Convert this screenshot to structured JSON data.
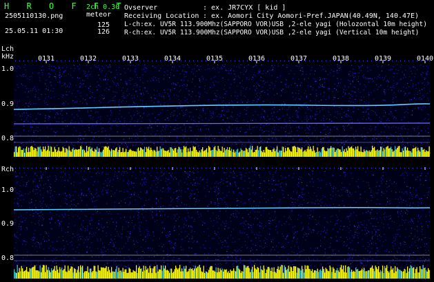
{
  "header": {
    "app_title": "H R O F F T",
    "version": "2ch 0.30",
    "filename": "2505110130.png",
    "mode": "meteor",
    "datetime": "25.05.11 01:30",
    "lch_count": "125",
    "rch_count": "126",
    "observer_label": "Ovserver",
    "observer_value": ": ex. JR7CYX [ kid ]",
    "location_label": "Receiving Location",
    "location_value": ": ex. Aomori City Aomori-Pref.JAPAN(40.49N, 140.47E)",
    "lch_info": "L-ch:ex. UV5R 113.900Mhz(SAPPORO VOR)USB ,2-ele yagi (Holozontal 10m height)",
    "rch_info": "R-ch:ex. UV5R 113.900Mhz(SAPPORO VOR)USB ,2-ele yagi (Vertical 10m height)"
  },
  "time_ticks": [
    "0131",
    "0132",
    "0133",
    "0134",
    "0135",
    "0136",
    "0137",
    "0138",
    "0139",
    "0140"
  ],
  "left_channel": {
    "label": "Lch",
    "unit": "kHz",
    "y_ticks": [
      "1.0",
      "0.9",
      "0.8"
    ]
  },
  "right_channel": {
    "label": "Rch",
    "y_ticks": [
      "1.0",
      "0.9",
      "0.8"
    ]
  },
  "colors": {
    "background": "#000000",
    "header_green": "#3cff3c",
    "noise_blue": "#1a1aa0",
    "signal_cyan": "#60d0ff",
    "activity_yellow": "#ffff00",
    "activity_cyan": "#40c0c0"
  }
}
